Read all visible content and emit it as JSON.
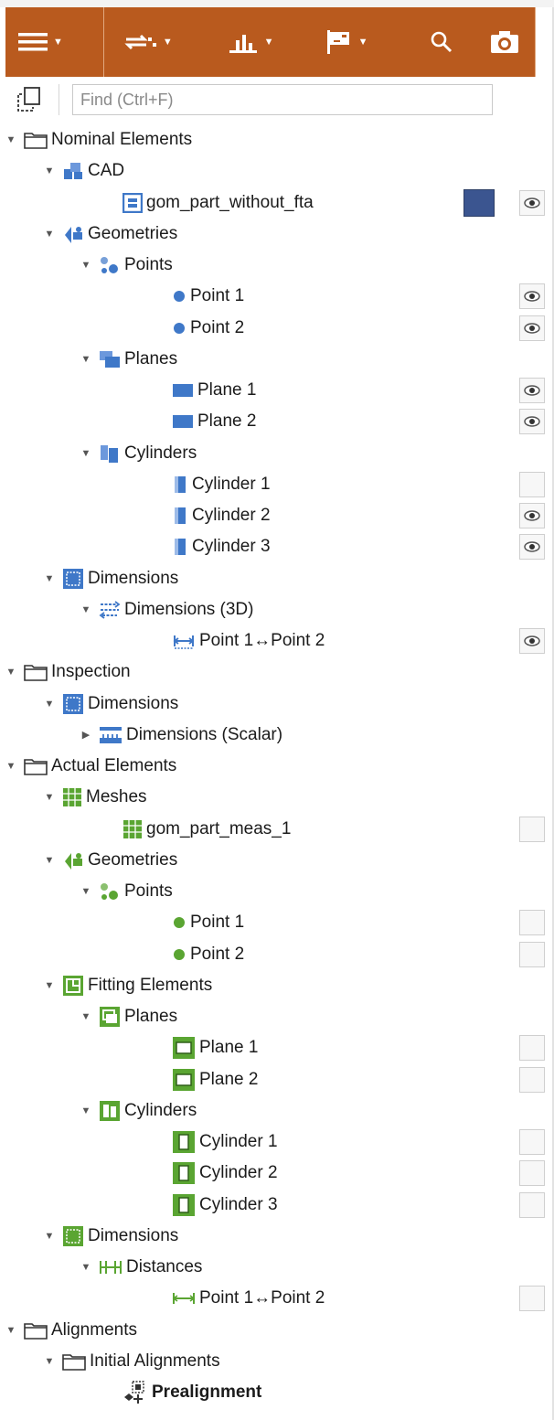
{
  "toolbar": {
    "buttons": [
      {
        "name": "menu-button",
        "icon": "hamburger-icon",
        "dropdown": true
      },
      {
        "name": "align-button",
        "icon": "transform-icon",
        "dropdown": true
      },
      {
        "name": "inspect-button",
        "icon": "chart-icon",
        "dropdown": true
      },
      {
        "name": "report-button",
        "icon": "report-icon",
        "dropdown": true
      },
      {
        "name": "search-button",
        "icon": "search-icon",
        "dropdown": false
      },
      {
        "name": "camera-button",
        "icon": "camera-icon",
        "dropdown": false
      }
    ],
    "color": "#b95a1e"
  },
  "search": {
    "placeholder": "Find (Ctrl+F)",
    "value": ""
  },
  "colors": {
    "nominal_blue": "#3f78c8",
    "actual_green": "#5aa532",
    "cad_swatch": "#3b5590"
  },
  "tree": [
    {
      "label": "Nominal Elements",
      "level": 0,
      "expand": "open",
      "icon": "folder-icon"
    },
    {
      "label": "CAD",
      "level": 1,
      "expand": "open",
      "icon": "cad-icon"
    },
    {
      "label": "gom_part_without_fta",
      "level": 3,
      "expand": "none",
      "icon": "part-icon",
      "swatch": true,
      "eye": "on"
    },
    {
      "label": "Geometries",
      "level": 1,
      "expand": "open",
      "icon": "geometries-icon"
    },
    {
      "label": "Points",
      "level": 2,
      "expand": "open",
      "icon": "points-icon"
    },
    {
      "label": "Point 1",
      "level": 4,
      "expand": "none",
      "icon": "point-icon",
      "eye": "on"
    },
    {
      "label": "Point 2",
      "level": 4,
      "expand": "none",
      "icon": "point-icon",
      "eye": "on"
    },
    {
      "label": "Planes",
      "level": 2,
      "expand": "open",
      "icon": "planes-icon"
    },
    {
      "label": "Plane 1",
      "level": 4,
      "expand": "none",
      "icon": "plane-icon",
      "eye": "on"
    },
    {
      "label": "Plane 2",
      "level": 4,
      "expand": "none",
      "icon": "plane-icon",
      "eye": "on"
    },
    {
      "label": "Cylinders",
      "level": 2,
      "expand": "open",
      "icon": "cylinders-icon"
    },
    {
      "label": "Cylinder 1",
      "level": 4,
      "expand": "none",
      "icon": "cylinder-icon",
      "eye": "off"
    },
    {
      "label": "Cylinder 2",
      "level": 4,
      "expand": "none",
      "icon": "cylinder-icon",
      "eye": "on"
    },
    {
      "label": "Cylinder 3",
      "level": 4,
      "expand": "none",
      "icon": "cylinder-icon",
      "eye": "on"
    },
    {
      "label": "Dimensions",
      "level": 1,
      "expand": "open",
      "icon": "dimensions-icon"
    },
    {
      "label": "Dimensions (3D)",
      "level": 2,
      "expand": "open",
      "icon": "dimensions-3d-icon"
    },
    {
      "label": "Point 1↔Point 2",
      "level": 4,
      "expand": "none",
      "icon": "distance-icon",
      "eye": "on"
    },
    {
      "label": "Inspection",
      "level": 0,
      "expand": "open",
      "icon": "folder-icon"
    },
    {
      "label": "Dimensions",
      "level": 1,
      "expand": "open",
      "icon": "dimensions-icon"
    },
    {
      "label": "Dimensions (Scalar)",
      "level": 2,
      "expand": "closed",
      "icon": "scalar-icon"
    },
    {
      "label": "Actual Elements",
      "level": 0,
      "expand": "open",
      "icon": "folder-icon"
    },
    {
      "label": "Meshes",
      "level": 1,
      "expand": "open",
      "icon": "meshes-icon"
    },
    {
      "label": "gom_part_meas_1",
      "level": 3,
      "expand": "none",
      "icon": "mesh-icon",
      "eye": "off"
    },
    {
      "label": "Geometries",
      "level": 1,
      "expand": "open",
      "icon": "geometries-green-icon"
    },
    {
      "label": "Points",
      "level": 2,
      "expand": "open",
      "icon": "points-green-icon"
    },
    {
      "label": "Point 1",
      "level": 4,
      "expand": "none",
      "icon": "point-green-icon",
      "eye": "off"
    },
    {
      "label": "Point 2",
      "level": 4,
      "expand": "none",
      "icon": "point-green-icon",
      "eye": "off"
    },
    {
      "label": "Fitting Elements",
      "level": 1,
      "expand": "open",
      "icon": "fitting-icon"
    },
    {
      "label": "Planes",
      "level": 2,
      "expand": "open",
      "icon": "planes-green-icon"
    },
    {
      "label": "Plane 1",
      "level": 4,
      "expand": "none",
      "icon": "plane-green-icon",
      "eye": "off"
    },
    {
      "label": "Plane 2",
      "level": 4,
      "expand": "none",
      "icon": "plane-green-icon",
      "eye": "off"
    },
    {
      "label": "Cylinders",
      "level": 2,
      "expand": "open",
      "icon": "cylinders-green-icon"
    },
    {
      "label": "Cylinder 1",
      "level": 4,
      "expand": "none",
      "icon": "cylinder-green-icon",
      "eye": "off"
    },
    {
      "label": "Cylinder 2",
      "level": 4,
      "expand": "none",
      "icon": "cylinder-green-icon",
      "eye": "off"
    },
    {
      "label": "Cylinder 3",
      "level": 4,
      "expand": "none",
      "icon": "cylinder-green-icon",
      "eye": "off"
    },
    {
      "label": "Dimensions",
      "level": 1,
      "expand": "open",
      "icon": "dimensions-green-icon"
    },
    {
      "label": "Distances",
      "level": 2,
      "expand": "open",
      "icon": "distances-icon"
    },
    {
      "label": "Point 1↔Point 2",
      "level": 4,
      "expand": "none",
      "icon": "distance-green-icon",
      "eye": "off"
    },
    {
      "label": "Alignments",
      "level": 0,
      "expand": "open",
      "icon": "folder-icon"
    },
    {
      "label": "Initial Alignments",
      "level": 1,
      "expand": "open",
      "icon": "folder-icon"
    },
    {
      "label": "Prealignment",
      "level": 3,
      "expand": "none",
      "icon": "prealignment-icon",
      "bold": true
    }
  ]
}
